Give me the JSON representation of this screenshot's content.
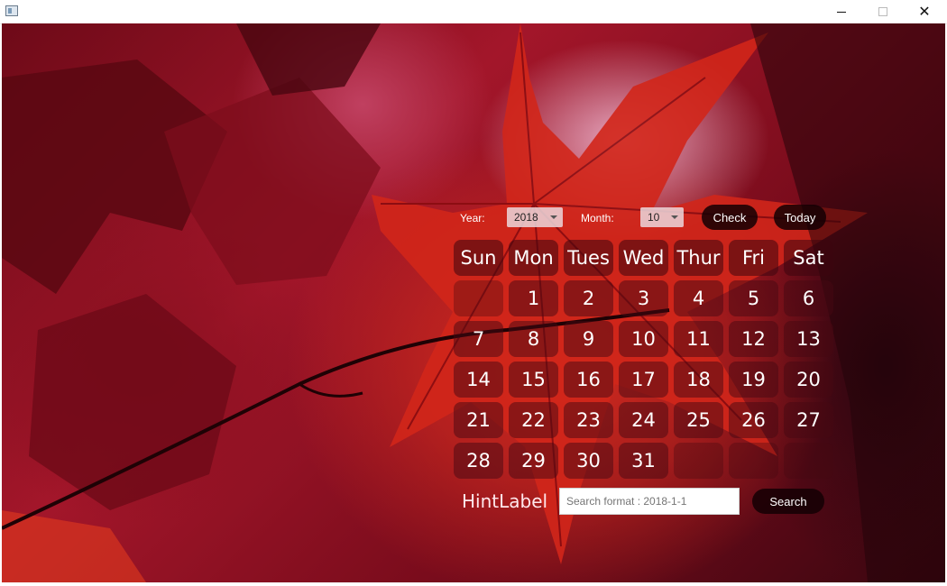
{
  "window": {
    "min_label": "—",
    "max_label": "☐",
    "close_label": "✕"
  },
  "controls": {
    "year_label": "Year:",
    "year_value": "2018",
    "month_label": "Month:",
    "month_value": "10",
    "check_label": "Check",
    "today_label": "Today"
  },
  "calendar": {
    "weekdays": [
      "Sun",
      "Mon",
      "Tues",
      "Wed",
      "Thur",
      "Fri",
      "Sat"
    ],
    "weeks": [
      [
        "",
        "1",
        "2",
        "3",
        "4",
        "5",
        "6"
      ],
      [
        "7",
        "8",
        "9",
        "10",
        "11",
        "12",
        "13"
      ],
      [
        "14",
        "15",
        "16",
        "17",
        "18",
        "19",
        "20"
      ],
      [
        "21",
        "22",
        "23",
        "24",
        "25",
        "26",
        "27"
      ],
      [
        "28",
        "29",
        "30",
        "31",
        "",
        "",
        ""
      ]
    ]
  },
  "search": {
    "hint_label": "HintLabel",
    "input_value": "",
    "input_placeholder": "Search format : 2018-1-1",
    "button_label": "Search"
  },
  "colors": {
    "accent_dark": "#140004",
    "background_red": "#a3162a"
  },
  "icons": {
    "app": "app-icon",
    "minimize": "minimize-icon",
    "maximize": "maximize-icon",
    "close": "close-icon",
    "dropdown": "chevron-down-icon"
  }
}
